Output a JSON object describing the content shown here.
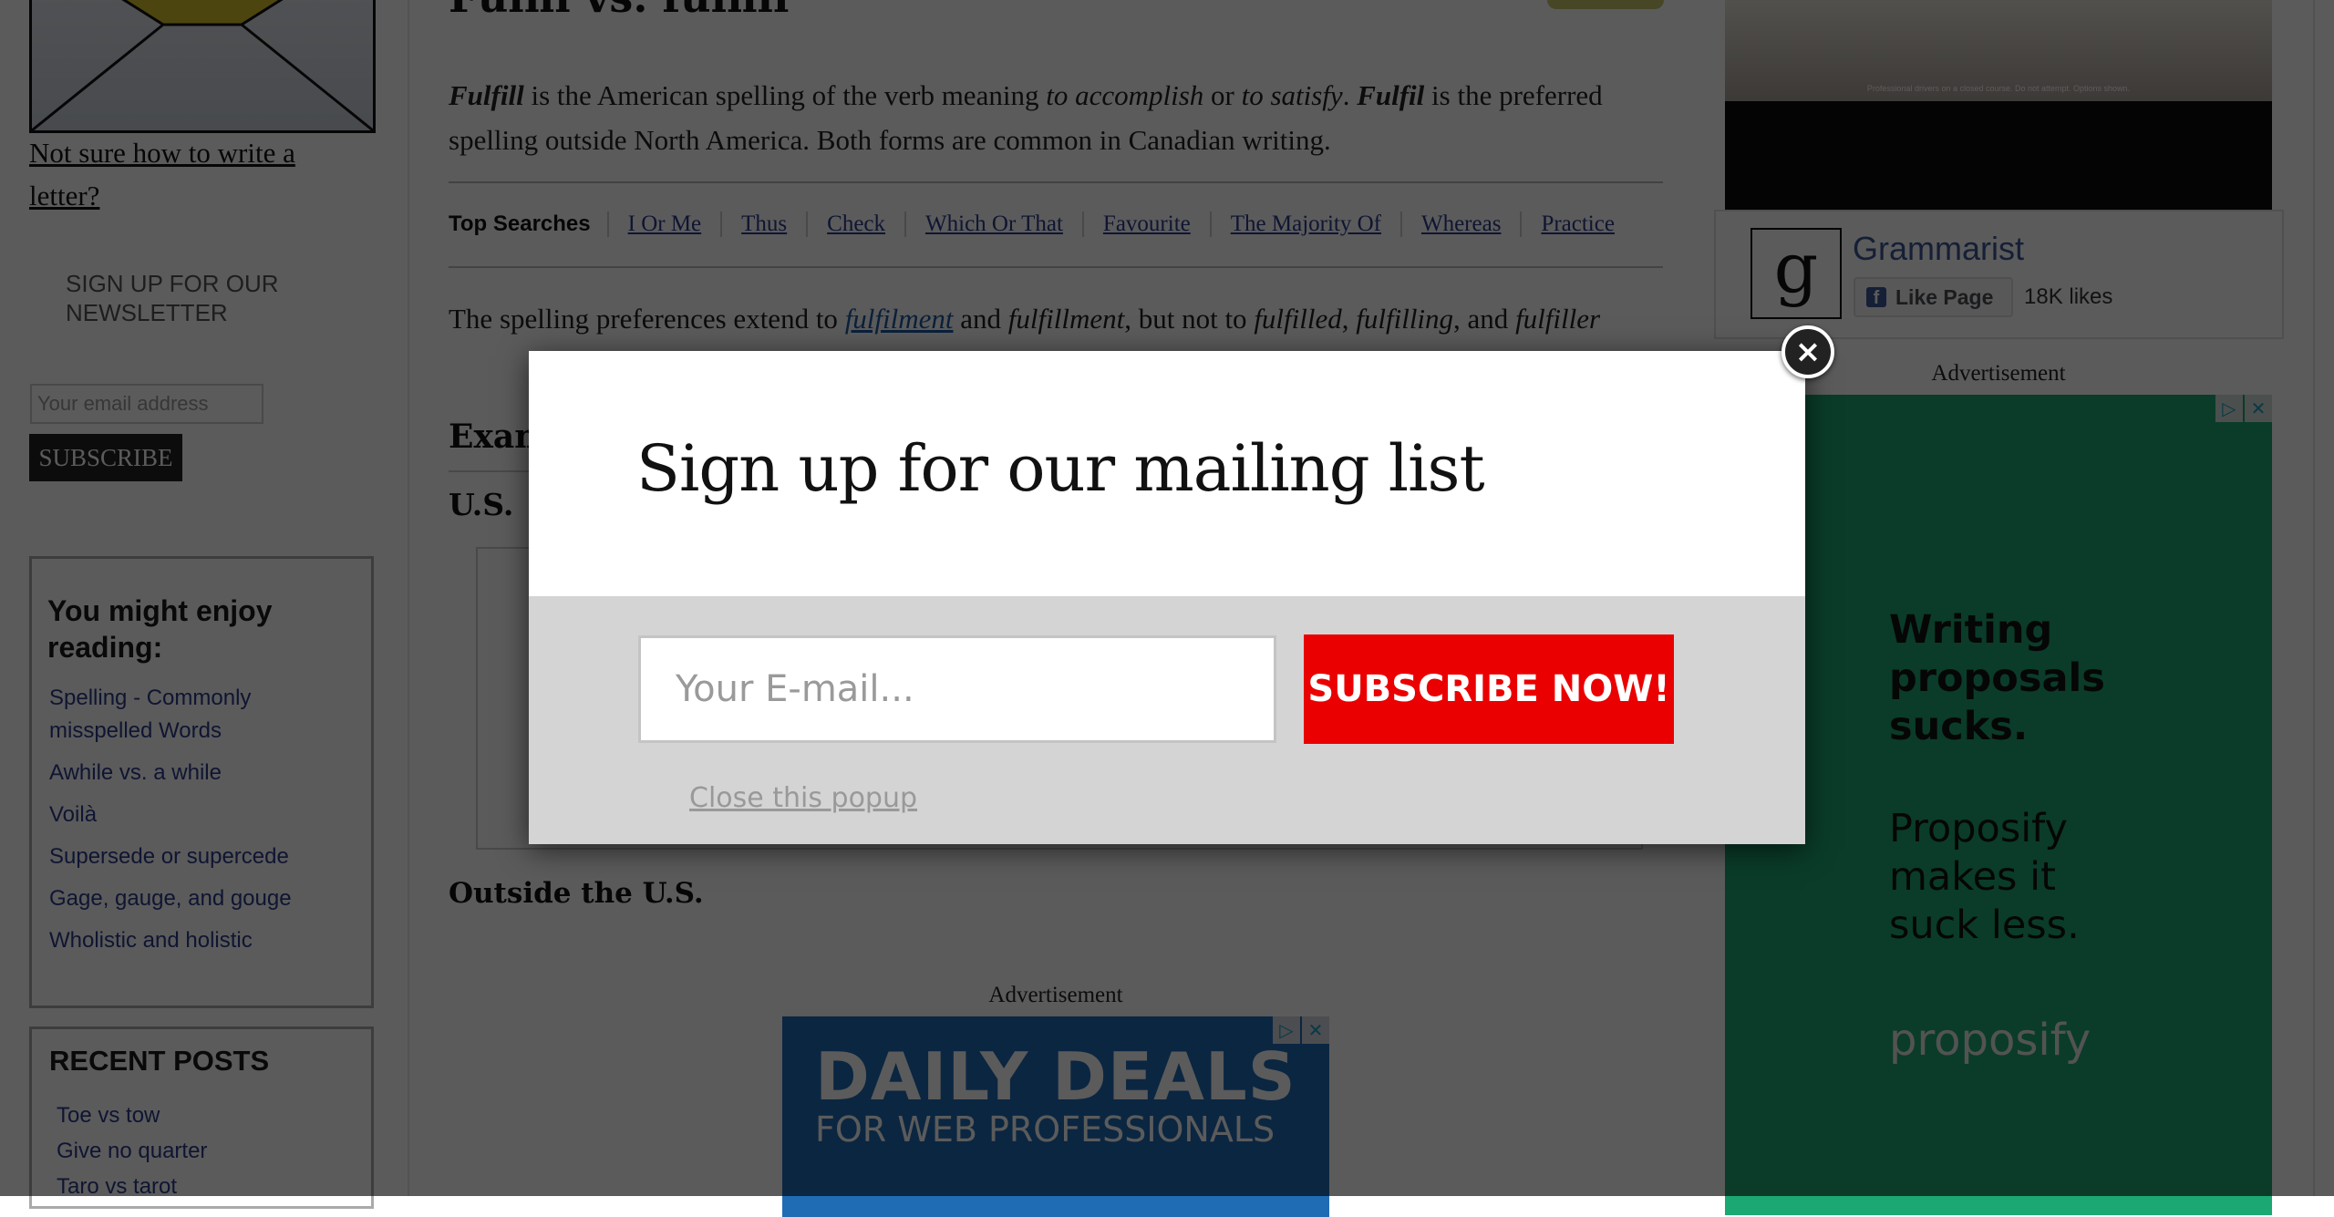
{
  "left_sidebar": {
    "letter_link": "Not sure how to write a letter?",
    "newsletter_title": "SIGN UP FOR OUR NEWSLETTER",
    "email_placeholder": "Your email address",
    "subscribe_label": "SUBSCRIBE",
    "enjoy": {
      "title": "You might enjoy reading:",
      "items": [
        "Spelling - Commonly misspelled Words",
        "Awhile vs. a while",
        "Voilà",
        "Supersede or supercede",
        "Gage, gauge, and gouge",
        "Wholistic and holistic"
      ]
    },
    "recent": {
      "title": "RECENT POSTS",
      "items": [
        "Toe vs tow",
        "Give no quarter",
        "Taro vs tarot"
      ]
    }
  },
  "article": {
    "title": "Fulfil vs. fulfill",
    "p1": {
      "b1": "Fulfill",
      "t1": " is the American spelling of the verb meaning ",
      "i1": "to accomplish",
      "t2": " or ",
      "i2": "to satisfy",
      "t3": ". ",
      "b2": "Fulfil",
      "t4": " is the preferred spelling outside North America. Both forms are common in Canadian writing."
    },
    "top_searches": {
      "label": "Top Searches",
      "links": [
        "I Or Me",
        "Thus",
        "Check",
        "Which Or That",
        "Favourite",
        "The Majority Of",
        "Whereas",
        "Practice"
      ]
    },
    "p2": {
      "t1": "The spelling preferences extend to ",
      "link": "fulfilment",
      "t2": " and ",
      "i1": "fulfillment",
      "t3": ", but not to ",
      "i2": "fulfilled",
      "t4": ", ",
      "i3": "fulfilling",
      "t5": ", and ",
      "i4": "fulfiller"
    },
    "h_examples": "Examples",
    "h_us": "U.S.",
    "h_outside": "Outside the U.S.",
    "ad_label": "Advertisement",
    "ad_deals": {
      "line1": "DAILY DEALS",
      "line2": "FOR WEB PROFESSIONALS"
    }
  },
  "right_sidebar": {
    "car_ad_caption": "Professional drivers on a closed course. Do not attempt. Options shown.",
    "facebook": {
      "logo_letter": "g",
      "page_name": "Grammarist",
      "like_label": "Like Page",
      "likes": "18K likes"
    },
    "ad_label": "Advertisement",
    "green_ad": {
      "headline": [
        "Writing",
        "proposals",
        "sucks."
      ],
      "sub": [
        "Proposify",
        "makes it",
        "suck less."
      ],
      "brand": "proposify"
    }
  },
  "adchoices": {
    "info": "▷",
    "close": "✕"
  },
  "popup": {
    "title": "Sign up for our mailing list",
    "email_placeholder": "Your E-mail...",
    "subscribe_label": "SUBSCRIBE NOW!",
    "close_link": "Close this popup",
    "close_icon": "×"
  },
  "colors": {
    "subscribe_red": "#ea0000",
    "link_blue": "#2b3b8c",
    "ad_green": "#1ca873",
    "overlay": "rgba(0,0,0,0.645)"
  }
}
